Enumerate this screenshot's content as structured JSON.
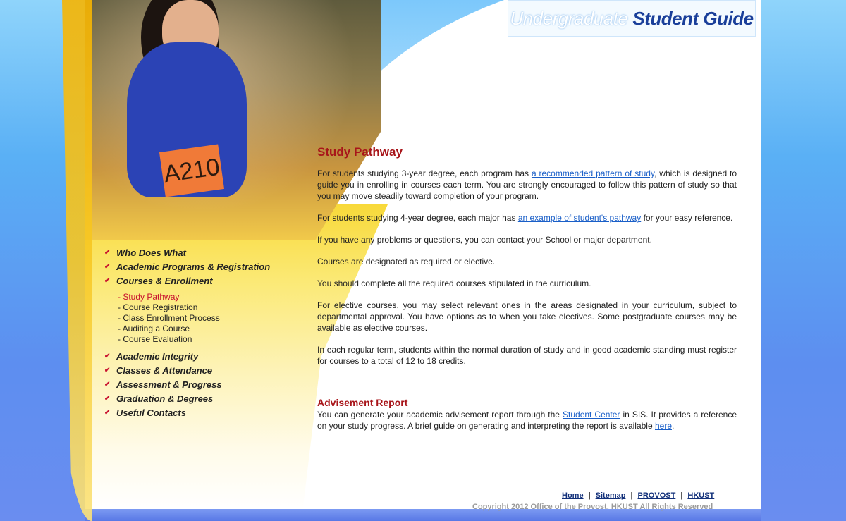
{
  "header": {
    "title_part1": "Undergraduate",
    "title_part2": "Student Guide",
    "bib_number": "A210"
  },
  "nav": {
    "items": [
      {
        "label": "Who Does What"
      },
      {
        "label": "Academic Programs & Registration"
      },
      {
        "label": "Courses & Enrollment"
      }
    ],
    "sub_items": [
      {
        "label": "- Study Pathway",
        "active": true
      },
      {
        "label": "- Course Registration"
      },
      {
        "label": "- Class Enrollment Process"
      },
      {
        "label": "- Auditing a Course"
      },
      {
        "label": "- Course Evaluation"
      }
    ],
    "items_after": [
      {
        "label": "Academic Integrity"
      },
      {
        "label": "Classes & Attendance"
      },
      {
        "label": "Assessment & Progress"
      },
      {
        "label": "Graduation & Degrees"
      },
      {
        "label": "Useful Contacts"
      }
    ]
  },
  "content": {
    "title": "Study Pathway",
    "p1_before": "For students studying 3-year degree, each program has ",
    "p1_link": "a recommended pattern of study",
    "p1_after": ", which is designed to guide you in enrolling in courses each term. You are strongly encouraged to follow this pattern of study so that you may move steadily toward completion of your program.",
    "p2_before": "For students studying 4-year degree, each major has ",
    "p2_link": "an example of student's pathway",
    "p2_after": " for your easy reference.",
    "p3": "If you have any problems or questions, you can contact your School or major department.",
    "p4": "Courses are designated as required or elective.",
    "p5": "You should complete all the required courses stipulated in the curriculum.",
    "p6": "For elective courses, you may select relevant ones in the areas designated in your curriculum, subject to departmental approval. You have options as to when you take electives. Some postgraduate courses may be available as elective courses.",
    "p7": "In each regular term, students within the normal duration of study and in good academic standing must register for courses to a total of 12 to 18 credits.",
    "advisement_title": "Advisement Report",
    "adv_before": "You can generate your academic advisement report through the ",
    "adv_link1": "Student Center",
    "adv_middle": " in SIS. It provides a reference on your study progress. A brief guide on generating and interpreting the report is available ",
    "adv_link2": "here",
    "adv_after": "."
  },
  "footer": {
    "home": "Home",
    "sitemap": "Sitemap",
    "provost": "PROVOST",
    "hkust": "HKUST",
    "separator": "|",
    "copyright": "Copyright 2012 Office of the Provost, HKUST   All Rights Reserved"
  },
  "colors": {
    "accent_red": "#a8151a",
    "link_blue": "#1a5fc8",
    "nav_chevron": "#c8102e"
  },
  "icons": {
    "nav_chevron": "chevron-down-icon"
  }
}
